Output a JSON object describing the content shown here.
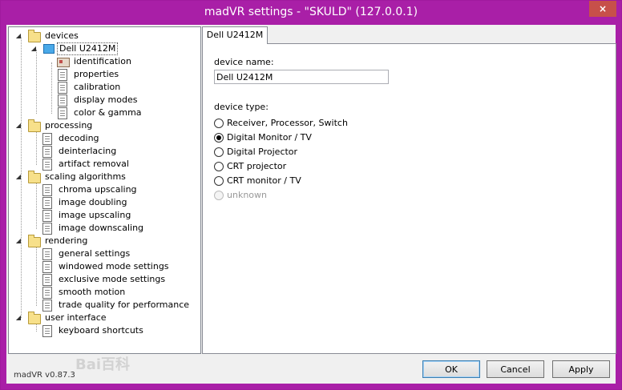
{
  "window": {
    "title": "madVR settings - \"SKULD\" (127.0.0.1)",
    "close_label": "×"
  },
  "tree": {
    "devices": "devices",
    "dell": "Dell U2412M",
    "identification": "identification",
    "properties": "properties",
    "calibration": "calibration",
    "display_modes": "display modes",
    "color_gamma": "color & gamma",
    "processing": "processing",
    "decoding": "decoding",
    "deinterlacing": "deinterlacing",
    "artifact_removal": "artifact removal",
    "scaling": "scaling algorithms",
    "chroma": "chroma upscaling",
    "doubling": "image doubling",
    "upscaling": "image upscaling",
    "downscaling": "image downscaling",
    "rendering": "rendering",
    "general": "general settings",
    "windowed": "windowed mode settings",
    "exclusive": "exclusive mode settings",
    "smooth": "smooth motion",
    "trade": "trade quality for performance",
    "user_interface": "user interface",
    "keyboard": "keyboard shortcuts",
    "collapse_glyph": "◢"
  },
  "panel": {
    "tab_label": "Dell U2412M",
    "device_name_label": "device name:",
    "device_name_value": "Dell U2412M",
    "device_type_label": "device type:",
    "types": [
      {
        "label": "Receiver, Processor, Switch"
      },
      {
        "label": "Digital Monitor / TV"
      },
      {
        "label": "Digital Projector"
      },
      {
        "label": "CRT projector"
      },
      {
        "label": "CRT monitor / TV"
      },
      {
        "label": "unknown"
      }
    ]
  },
  "footer": {
    "version": "madVR v0.87.3",
    "watermark": "Bai百科",
    "ok": "OK",
    "cancel": "Cancel",
    "apply": "Apply"
  },
  "colors": {
    "titlebar": "#a91fa7",
    "close": "#c7504a",
    "background": "#f0f0f0"
  }
}
